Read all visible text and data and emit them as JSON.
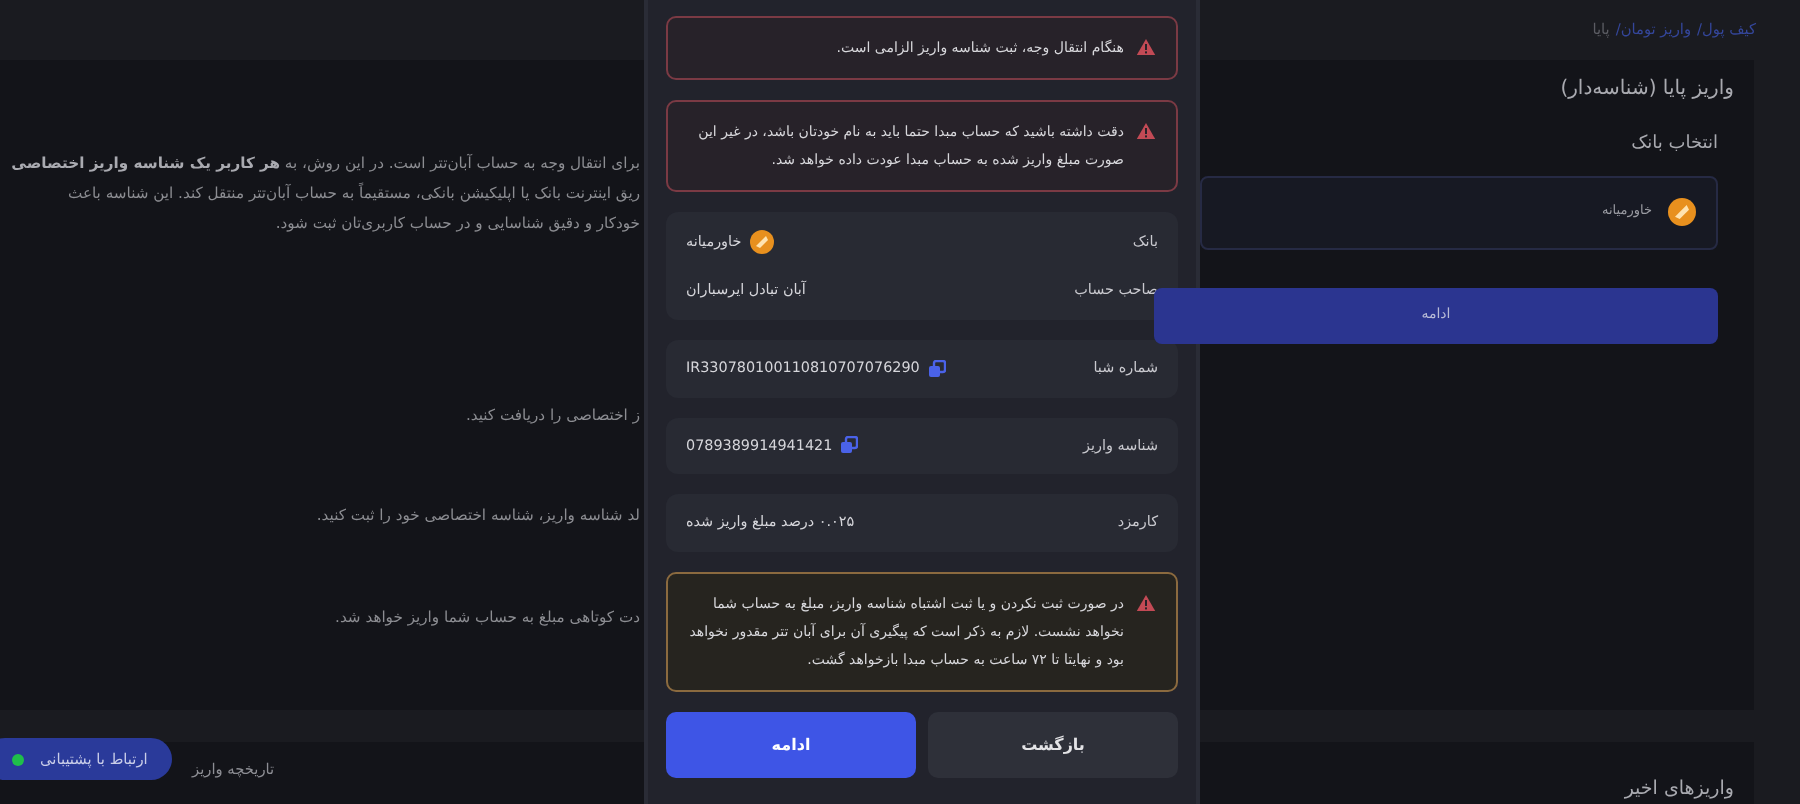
{
  "background": {
    "breadcrumb": [
      {
        "label": "کیف پول/",
        "link": true
      },
      {
        "label": "واریز تومان/",
        "link": true
      },
      {
        "label": "پایا",
        "link": false
      }
    ],
    "card_title": "واریز پایا (شناسه‌دار)",
    "intro_lines": [
      "برای انتقال وجه به حساب آبان‌تتر است. در این روش، به **هر کاربر یک شناسه واریز اختصاصی**",
      "ریق اینترنت بانک یا اپلیکیشن بانکی، مستقیماً به حساب آبان‌تتر منتقل کند. این شناسه باعث",
      "خودکار و دقیق شناسایی و در حساب کاربری‌تان ثبت شود."
    ],
    "steps": [
      "ز اختصاصی را دریافت کنید.",
      "لد شناسه واریز، شناسه اختصاصی خود را ثبت کنید.",
      "دت کوتاهی مبلغ به حساب شما واریز خواهد شد."
    ],
    "bank_section": {
      "title": "انتخاب بانک",
      "bank": "خاورمیانه",
      "button": "ادامه"
    },
    "recent_title": "واریزهای اخیر",
    "history_tab": "تاریخچه واریز",
    "support": {
      "label": "ارتباط با پشتیبانی",
      "online": true
    }
  },
  "modal": {
    "alerts_top": [
      {
        "kind": "danger",
        "text": "هنگام انتقال وجه، ثبت شناسه واریز الزامی است."
      },
      {
        "kind": "danger",
        "text": "دقت داشته باشید که حساب مبدا حتما باید به نام خودتان باشد، در غیر این صورت مبلغ واریز شده به حساب مبدا عودت داده خواهد شد."
      }
    ],
    "details": [
      {
        "rows": [
          {
            "label": "بانک",
            "value": "خاورمیانه",
            "kind": "bank"
          },
          {
            "label": "صاحب حساب",
            "value": "آبان تبادل ایرسباران",
            "kind": "text"
          }
        ]
      },
      {
        "rows": [
          {
            "label": "شماره شبا",
            "value": "IR330780100110810707076290",
            "kind": "copy"
          }
        ]
      },
      {
        "rows": [
          {
            "label": "شناسه واریز",
            "value": "0789389914941421",
            "kind": "copy"
          }
        ]
      },
      {
        "rows": [
          {
            "label": "کارمزد",
            "value": "۰.۰۲۵ درصد مبلغ واریز شده",
            "kind": "text"
          }
        ]
      }
    ],
    "alerts_bottom": [
      {
        "kind": "warning",
        "text": "در صورت ثبت نکردن و یا ثبت اشتباه شناسه واریز، مبلغ به حساب شما نخواهد نشست. لازم به ذکر است که پیگیری آن برای آبان تتر مقدور نخواهد بود و نهایتا تا ۷۲ ساعت به حساب مبدا بازخواهد گشت."
      }
    ],
    "buttons": [
      {
        "label": "بازگشت",
        "kind": "secondary"
      },
      {
        "label": "ادامه",
        "kind": "primary"
      }
    ]
  }
}
